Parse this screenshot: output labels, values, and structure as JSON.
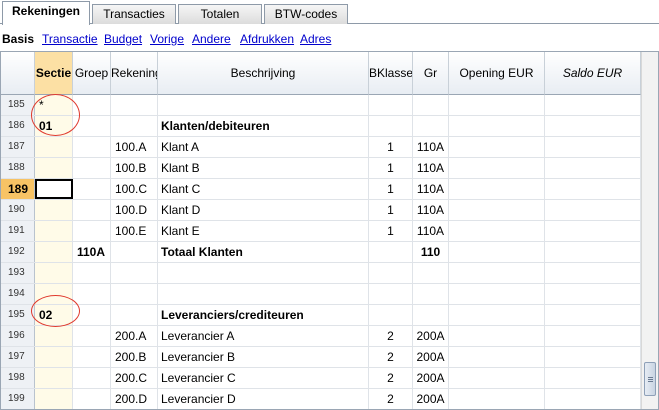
{
  "tabs": [
    {
      "label": "Rekeningen",
      "active": true
    },
    {
      "label": "Transacties",
      "active": false
    },
    {
      "label": "Totalen",
      "active": false
    },
    {
      "label": "BTW-codes",
      "active": false
    }
  ],
  "views": [
    {
      "label": "Basis",
      "active": true
    },
    {
      "label": "Transactie",
      "active": false
    },
    {
      "label": "Budget",
      "active": false
    },
    {
      "label": "Vorige",
      "active": false
    },
    {
      "label": "Andere",
      "active": false
    },
    {
      "label": "Afdrukken",
      "active": false
    },
    {
      "label": "Adres",
      "active": false
    }
  ],
  "columns": {
    "sectie": "Sectie",
    "groep": "Groep",
    "rekening": "Rekening",
    "beschrijving": "Beschrijving",
    "bklasse": "BKlasse",
    "gr": "Gr",
    "opening": "Opening EUR",
    "saldo": "Saldo EUR"
  },
  "rows": [
    {
      "num": "185",
      "sectie": "*",
      "groep": "",
      "rekening": "",
      "beschrijving": "",
      "bklasse": "",
      "gr": "",
      "bold": false
    },
    {
      "num": "186",
      "sectie": "01",
      "groep": "",
      "rekening": "",
      "beschrijving": "Klanten/debiteuren",
      "bklasse": "",
      "gr": "",
      "bold": true
    },
    {
      "num": "187",
      "sectie": "",
      "groep": "",
      "rekening": "100.A",
      "beschrijving": "Klant A",
      "bklasse": "1",
      "gr": "110A",
      "bold": false
    },
    {
      "num": "188",
      "sectie": "",
      "groep": "",
      "rekening": "100.B",
      "beschrijving": "Klant B",
      "bklasse": "1",
      "gr": "110A",
      "bold": false
    },
    {
      "num": "189",
      "sectie": "",
      "groep": "",
      "rekening": "100.C",
      "beschrijving": "Klant C",
      "bklasse": "1",
      "gr": "110A",
      "bold": false,
      "current": true
    },
    {
      "num": "190",
      "sectie": "",
      "groep": "",
      "rekening": "100.D",
      "beschrijving": "Klant D",
      "bklasse": "1",
      "gr": "110A",
      "bold": false
    },
    {
      "num": "191",
      "sectie": "",
      "groep": "",
      "rekening": "100.E",
      "beschrijving": "Klant E",
      "bklasse": "1",
      "gr": "110A",
      "bold": false
    },
    {
      "num": "192",
      "sectie": "",
      "groep": "110A",
      "rekening": "",
      "beschrijving": "Totaal Klanten",
      "bklasse": "",
      "gr": "110",
      "bold": true
    },
    {
      "num": "193",
      "sectie": "",
      "groep": "",
      "rekening": "",
      "beschrijving": "",
      "bklasse": "",
      "gr": "",
      "bold": false
    },
    {
      "num": "194",
      "sectie": "",
      "groep": "",
      "rekening": "",
      "beschrijving": "",
      "bklasse": "",
      "gr": "",
      "bold": false
    },
    {
      "num": "195",
      "sectie": "02",
      "groep": "",
      "rekening": "",
      "beschrijving": "Leveranciers/crediteuren",
      "bklasse": "",
      "gr": "",
      "bold": true
    },
    {
      "num": "196",
      "sectie": "",
      "groep": "",
      "rekening": "200.A",
      "beschrijving": "Leverancier A",
      "bklasse": "2",
      "gr": "200A",
      "bold": false
    },
    {
      "num": "197",
      "sectie": "",
      "groep": "",
      "rekening": "200.B",
      "beschrijving": "Leverancier B",
      "bklasse": "2",
      "gr": "200A",
      "bold": false
    },
    {
      "num": "198",
      "sectie": "",
      "groep": "",
      "rekening": "200.C",
      "beschrijving": "Leverancier C",
      "bklasse": "2",
      "gr": "200A",
      "bold": false
    },
    {
      "num": "199",
      "sectie": "",
      "groep": "",
      "rekening": "200.D",
      "beschrijving": "Leverancier D",
      "bklasse": "2",
      "gr": "200A",
      "bold": false
    }
  ],
  "colors": {
    "sectie_header": "#fce0a4",
    "current_row_number": "#f7c365",
    "annotation_circle": "#e03a2e",
    "link": "#0000cc"
  }
}
